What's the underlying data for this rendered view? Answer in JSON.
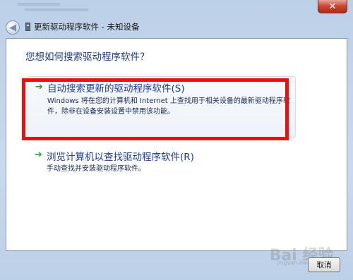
{
  "window": {
    "title": "更新驱动程序软件 - 未知设备",
    "close_glyph": "✕",
    "back_glyph": "◀"
  },
  "main": {
    "question": "您想如何搜索驱动程序软件？",
    "options": [
      {
        "title": "自动搜索更新的驱动程序软件(S)",
        "description": "Windows 将在您的计算机和 Internet 上查找用于相关设备的最新驱动程序软件，除非在设备安装设置中禁用该功能。"
      },
      {
        "title": "浏览计算机以查找驱动程序软件(R)",
        "description": "手动查找并安装驱动程序软件。"
      }
    ],
    "arrow_glyph": "➔",
    "arrow_color": "#2e9e3a",
    "highlight_color": "#f20c0c"
  },
  "footer": {
    "cancel_label": "取消"
  },
  "watermark": {
    "brand": "Bai 经验",
    "site": "jingyan.baidu.com"
  }
}
